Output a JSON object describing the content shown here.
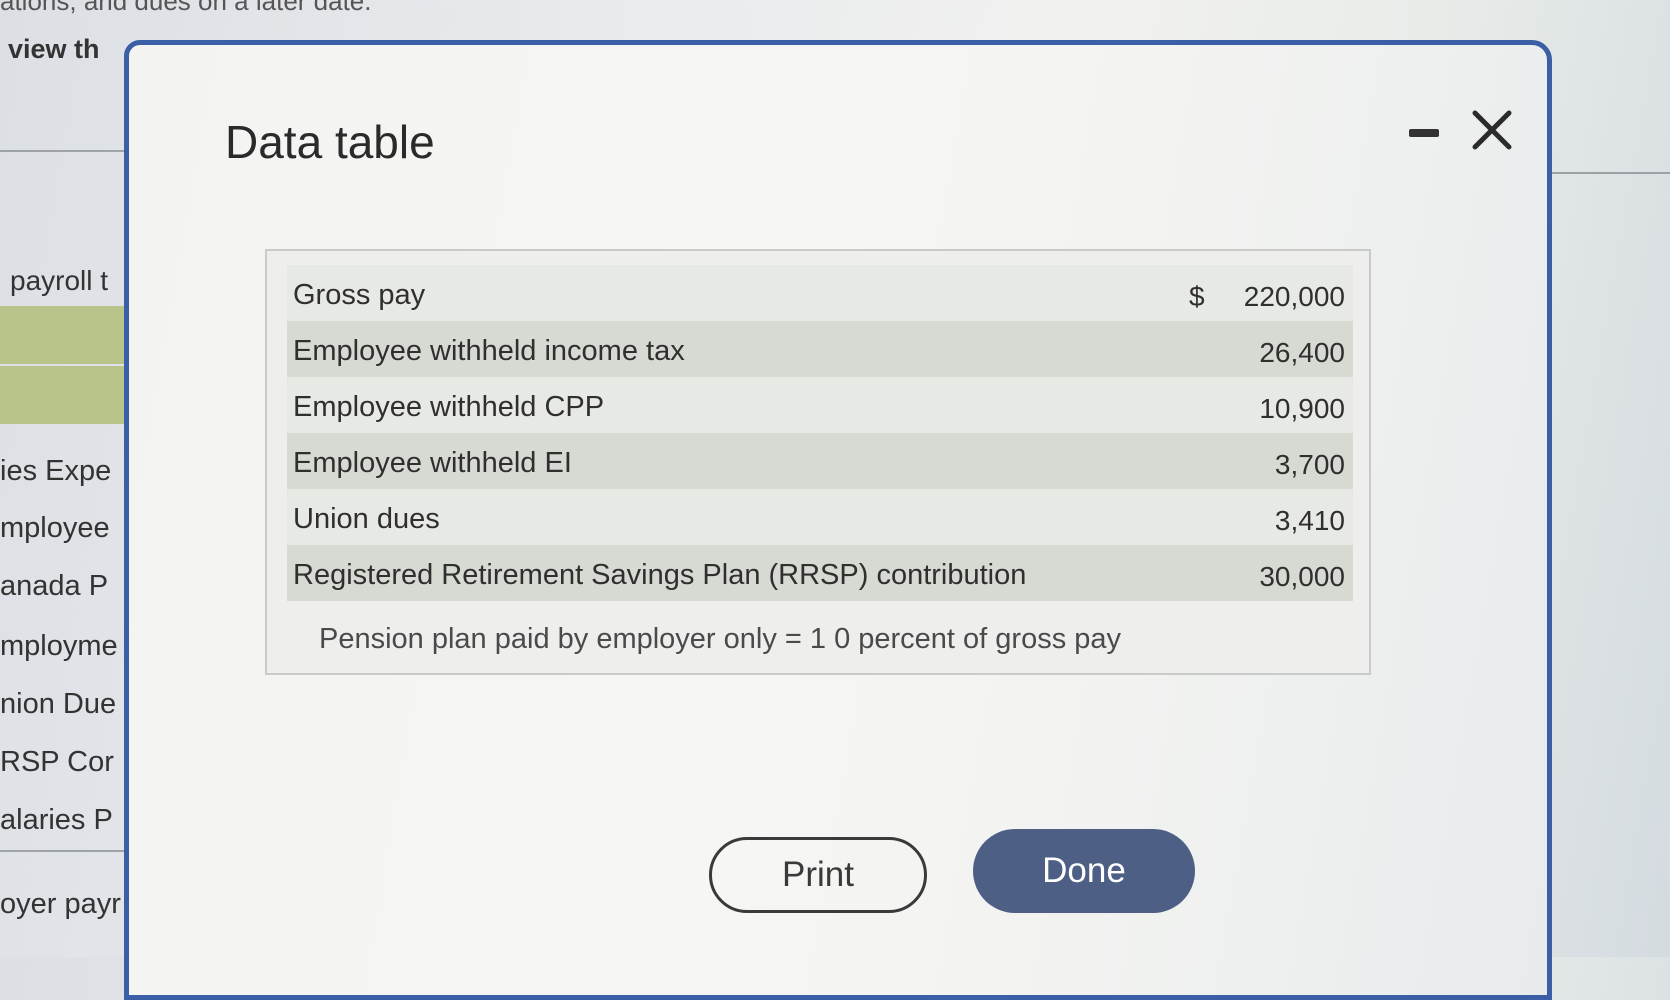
{
  "background": {
    "top_fragment": "ations, and dues on a later date.",
    "view_label": "view th",
    "payroll_label": "payroll t",
    "items": [
      "ies Expe",
      "mployee",
      "anada P",
      "mployme",
      "nion Due",
      "RSP Cor",
      "alaries P",
      "oyer payr"
    ]
  },
  "dialog": {
    "title": "Data table",
    "minimize_icon": "minimize-icon",
    "close_icon": "close-icon",
    "rows": [
      {
        "label": "Gross pay",
        "currency": "$",
        "value": "220,000"
      },
      {
        "label": "Employee withheld income tax",
        "currency": "",
        "value": "26,400"
      },
      {
        "label": "Employee withheld CPP",
        "currency": "",
        "value": "10,900"
      },
      {
        "label": "Employee withheld EI",
        "currency": "",
        "value": "3,700"
      },
      {
        "label": "Union dues",
        "currency": "",
        "value": "3,410"
      },
      {
        "label": "Registered Retirement Savings Plan (RRSP) contribution",
        "currency": "",
        "value": "30,000"
      }
    ],
    "note": "Pension plan paid by employer only = 1 0 percent of gross pay",
    "print_label": "Print",
    "done_label": "Done"
  },
  "colors": {
    "dialog_border": "#3a5fa6",
    "done_button": "#4d5f85",
    "row_highlight": "#d7dad3"
  }
}
